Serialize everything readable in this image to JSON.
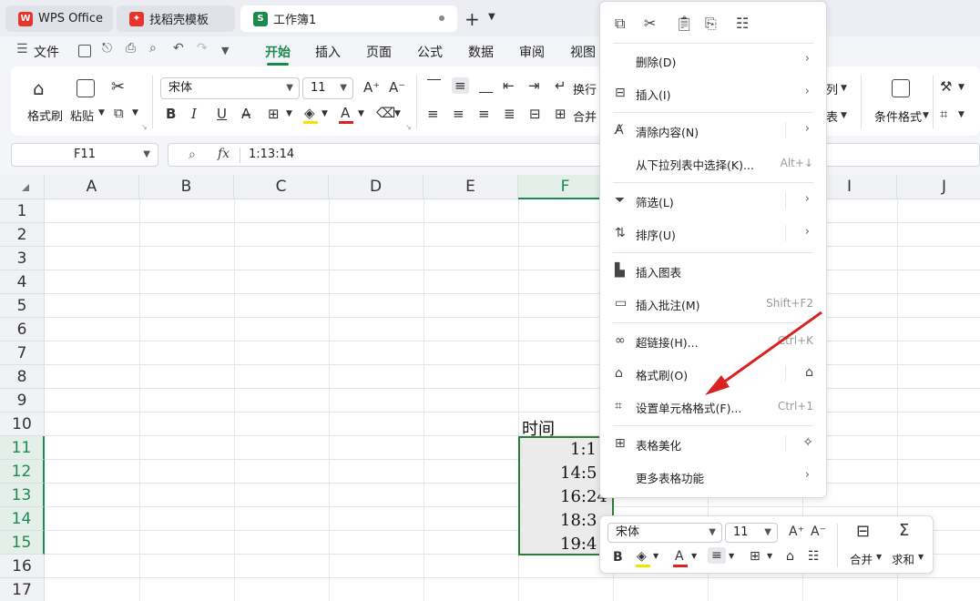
{
  "tabs": [
    {
      "label": "WPS Office",
      "icon": "wps-logo-icon"
    },
    {
      "label": "找稻壳模板",
      "icon": "docer-logo-icon"
    },
    {
      "label": "工作簿1",
      "icon": "spreadsheet-s-icon",
      "badge": "S"
    }
  ],
  "menu": {
    "file": "文件",
    "items": [
      "开始",
      "插入",
      "页面",
      "公式",
      "数据",
      "审阅",
      "视图"
    ],
    "active": "开始"
  },
  "ribbon": {
    "format_painter": "格式刷",
    "paste": "粘贴",
    "font_name": "宋体",
    "font_size": "11",
    "wrap": "换行",
    "merge": "合并",
    "col_text": "列",
    "table_text": "表",
    "conditional_format": "条件格式",
    "bold": "B",
    "italic": "I",
    "underline": "U",
    "font_color_glyph": "A",
    "grow_font": "A⁺",
    "shrink_font": "A⁻"
  },
  "formula_bar": {
    "name_box": "F11",
    "fx": "fx",
    "value": "1:13:14"
  },
  "grid": {
    "columns": [
      "A",
      "B",
      "C",
      "D",
      "E",
      "F",
      "G",
      "H",
      "I",
      "J"
    ],
    "rows": [
      "1",
      "2",
      "3",
      "4",
      "5",
      "6",
      "7",
      "8",
      "9",
      "10",
      "11",
      "12",
      "13",
      "14",
      "15",
      "16",
      "17"
    ],
    "selected_column": "F",
    "selected_rows": [
      "11",
      "12",
      "13",
      "14",
      "15"
    ],
    "header_cell": "时间",
    "cells": [
      "1:1",
      "14:5",
      "16:24",
      "18:3",
      "19:4"
    ]
  },
  "context_menu": {
    "items": [
      {
        "label": "删除(D)",
        "shortcut": "",
        "submenu": true,
        "icon": ""
      },
      {
        "label": "插入(I)",
        "shortcut": "",
        "submenu": true,
        "icon": "insert-icon"
      },
      {
        "label": "清除内容(N)",
        "shortcut": "",
        "submenu": true,
        "icon": "clear-icon"
      },
      {
        "label": "从下拉列表中选择(K)...",
        "shortcut": "Alt+↓",
        "submenu": false,
        "icon": ""
      },
      {
        "label": "筛选(L)",
        "shortcut": "",
        "submenu": true,
        "icon": "filter-icon"
      },
      {
        "label": "排序(U)",
        "shortcut": "",
        "submenu": true,
        "icon": "sort-icon"
      },
      {
        "label": "插入图表",
        "shortcut": "",
        "submenu": false,
        "icon": "chart-icon"
      },
      {
        "label": "插入批注(M)",
        "shortcut": "Shift+F2",
        "submenu": false,
        "icon": "comment-icon"
      },
      {
        "label": "超链接(H)...",
        "shortcut": "Ctrl+K",
        "submenu": false,
        "icon": "link-icon"
      },
      {
        "label": "格式刷(O)",
        "shortcut": "",
        "submenu": false,
        "icon": "format-painter-icon"
      },
      {
        "label": "设置单元格格式(F)...",
        "shortcut": "Ctrl+1",
        "submenu": false,
        "icon": "cell-format-icon"
      },
      {
        "label": "表格美化",
        "shortcut": "",
        "submenu": false,
        "icon": "table-beautify-icon"
      },
      {
        "label": "更多表格功能",
        "shortcut": "",
        "submenu": true,
        "icon": ""
      }
    ]
  },
  "mini_toolbar": {
    "font_name": "宋体",
    "font_size": "11",
    "merge": "合并",
    "sum": "求和",
    "bold": "B"
  },
  "colors": {
    "accent": "#1b8a4e",
    "selection_border": "#2f7d3a",
    "arrow": "#d92222"
  }
}
